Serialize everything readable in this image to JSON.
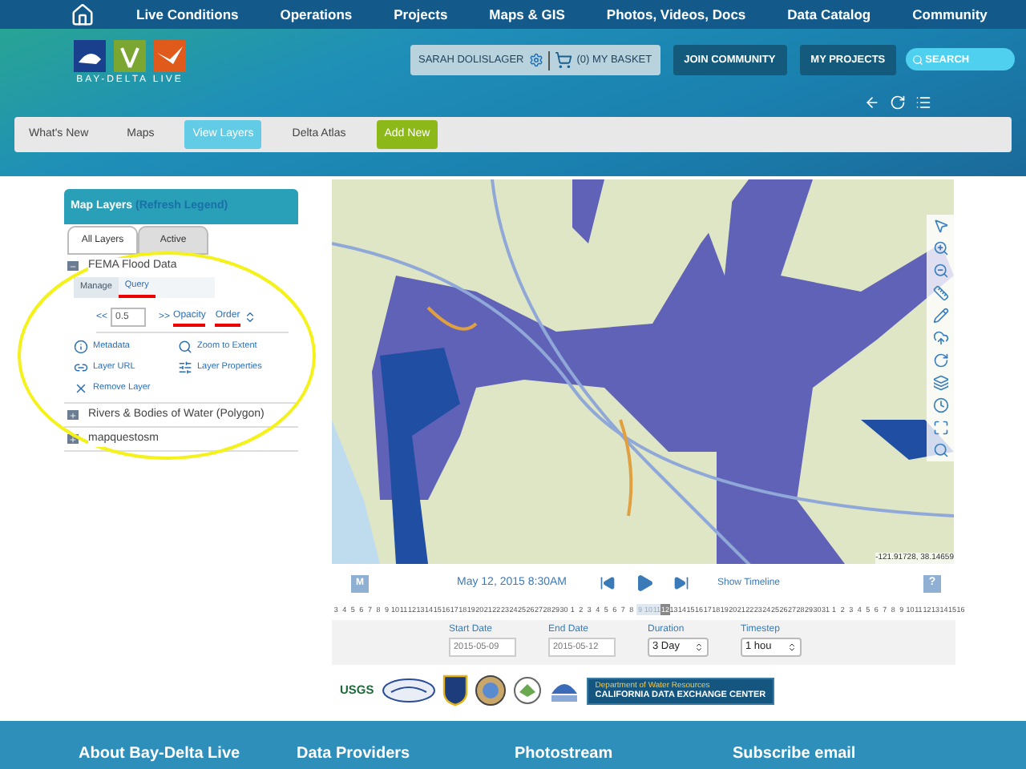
{
  "top_nav": {
    "items": [
      "Live Conditions",
      "Operations",
      "Projects",
      "Maps & GIS",
      "Photos, Videos, Docs",
      "Data Catalog",
      "Community"
    ]
  },
  "logo": {
    "text": "BAY-DELTA LIVE"
  },
  "user_bar": {
    "user": "SARAH DOLISLAGER",
    "basket": "(0) MY BASKET"
  },
  "header_buttons": [
    "JOIN COMMUNITY",
    "MY PROJECTS"
  ],
  "search": {
    "placeholder": "SEARCH"
  },
  "sub_nav": [
    {
      "label": "What's New",
      "kind": "plain",
      "selected": false
    },
    {
      "label": "Maps",
      "kind": "plain",
      "selected": false
    },
    {
      "label": "View Layers",
      "kind": "plain",
      "selected": true
    },
    {
      "label": "Delta Atlas",
      "kind": "plain",
      "selected": false
    },
    {
      "label": "Add New",
      "kind": "action",
      "selected": false
    }
  ],
  "layers_panel": {
    "title": "Map Layers",
    "refresh": "(Refresh Legend)",
    "tabs": [
      {
        "label": "All Layers",
        "selected": true
      },
      {
        "label": "Active",
        "selected": false
      }
    ],
    "layers": [
      {
        "name": "FEMA Flood Data",
        "expanded": true
      },
      {
        "name": "Rivers & Bodies of Water (Polygon)",
        "expanded": false
      },
      {
        "name": "mapquestosm",
        "expanded": false
      }
    ],
    "layer_tabs": [
      {
        "label": "Manage",
        "selected": true,
        "marked": false
      },
      {
        "label": "Query",
        "selected": false,
        "marked": true
      }
    ],
    "opacity": {
      "less": "<<",
      "value": "0.5",
      "more": ">>",
      "label": "Opacity",
      "marked": true
    },
    "order": {
      "label": "Order",
      "marked": true
    },
    "actions": [
      {
        "label": "Metadata",
        "kind": "metadata"
      },
      {
        "label": "Zoom to Extent",
        "kind": "zoom"
      },
      {
        "label": "Layer URL",
        "kind": "url"
      },
      {
        "label": "Layer Properties",
        "kind": "properties"
      },
      {
        "label": "Remove Layer",
        "kind": "remove"
      }
    ],
    "highlight_ellipse": true
  },
  "map": {
    "coordinates": "-121.91728, 38.14659"
  },
  "player": {
    "mode": "M",
    "datetime": "May 12, 2015 8:30AM",
    "timeline": "Show Timeline",
    "help": "?"
  },
  "days": [
    {
      "day": "3",
      "selected": false,
      "current": false
    },
    {
      "day": "4",
      "selected": false,
      "current": false
    },
    {
      "day": "5",
      "selected": false,
      "current": false
    },
    {
      "day": "6",
      "selected": false,
      "current": false
    },
    {
      "day": "7",
      "selected": false,
      "current": false
    },
    {
      "day": "8",
      "selected": false,
      "current": false
    },
    {
      "day": "9",
      "selected": false,
      "current": false
    },
    {
      "day": "10",
      "selected": false,
      "current": false
    },
    {
      "day": "11",
      "selected": false,
      "current": false
    },
    {
      "day": "12",
      "selected": false,
      "current": false
    },
    {
      "day": "13",
      "selected": false,
      "current": false
    },
    {
      "day": "14",
      "selected": false,
      "current": false
    },
    {
      "day": "15",
      "selected": false,
      "current": false
    },
    {
      "day": "16",
      "selected": false,
      "current": false
    },
    {
      "day": "17",
      "selected": false,
      "current": false
    },
    {
      "day": "18",
      "selected": false,
      "current": false
    },
    {
      "day": "19",
      "selected": false,
      "current": false
    },
    {
      "day": "20",
      "selected": false,
      "current": false
    },
    {
      "day": "21",
      "selected": false,
      "current": false
    },
    {
      "day": "22",
      "selected": false,
      "current": false
    },
    {
      "day": "23",
      "selected": false,
      "current": false
    },
    {
      "day": "24",
      "selected": false,
      "current": false
    },
    {
      "day": "25",
      "selected": false,
      "current": false
    },
    {
      "day": "26",
      "selected": false,
      "current": false
    },
    {
      "day": "27",
      "selected": false,
      "current": false
    },
    {
      "day": "28",
      "selected": false,
      "current": false
    },
    {
      "day": "29",
      "selected": false,
      "current": false
    },
    {
      "day": "30",
      "selected": false,
      "current": false
    },
    {
      "day": "1",
      "selected": false,
      "current": false
    },
    {
      "day": "2",
      "selected": false,
      "current": false
    },
    {
      "day": "3",
      "selected": false,
      "current": false
    },
    {
      "day": "4",
      "selected": false,
      "current": false
    },
    {
      "day": "5",
      "selected": false,
      "current": false
    },
    {
      "day": "6",
      "selected": false,
      "current": false
    },
    {
      "day": "7",
      "selected": false,
      "current": false
    },
    {
      "day": "8",
      "selected": false,
      "current": false
    },
    {
      "day": "9",
      "selected": true,
      "current": false
    },
    {
      "day": "10",
      "selected": true,
      "current": false
    },
    {
      "day": "11",
      "selected": true,
      "current": false
    },
    {
      "day": "12",
      "selected": true,
      "current": true
    },
    {
      "day": "13",
      "selected": false,
      "current": false
    },
    {
      "day": "14",
      "selected": false,
      "current": false
    },
    {
      "day": "15",
      "selected": false,
      "current": false
    },
    {
      "day": "16",
      "selected": false,
      "current": false
    },
    {
      "day": "17",
      "selected": false,
      "current": false
    },
    {
      "day": "18",
      "selected": false,
      "current": false
    },
    {
      "day": "19",
      "selected": false,
      "current": false
    },
    {
      "day": "20",
      "selected": false,
      "current": false
    },
    {
      "day": "21",
      "selected": false,
      "current": false
    },
    {
      "day": "22",
      "selected": false,
      "current": false
    },
    {
      "day": "23",
      "selected": false,
      "current": false
    },
    {
      "day": "24",
      "selected": false,
      "current": false
    },
    {
      "day": "25",
      "selected": false,
      "current": false
    },
    {
      "day": "26",
      "selected": false,
      "current": false
    },
    {
      "day": "27",
      "selected": false,
      "current": false
    },
    {
      "day": "28",
      "selected": false,
      "current": false
    },
    {
      "day": "29",
      "selected": false,
      "current": false
    },
    {
      "day": "30",
      "selected": false,
      "current": false
    },
    {
      "day": "31",
      "selected": false,
      "current": false
    },
    {
      "day": "1",
      "selected": false,
      "current": false
    },
    {
      "day": "2",
      "selected": false,
      "current": false
    },
    {
      "day": "3",
      "selected": false,
      "current": false
    },
    {
      "day": "4",
      "selected": false,
      "current": false
    },
    {
      "day": "5",
      "selected": false,
      "current": false
    },
    {
      "day": "6",
      "selected": false,
      "current": false
    },
    {
      "day": "7",
      "selected": false,
      "current": false
    },
    {
      "day": "8",
      "selected": false,
      "current": false
    },
    {
      "day": "9",
      "selected": false,
      "current": false
    },
    {
      "day": "10",
      "selected": false,
      "current": false
    },
    {
      "day": "11",
      "selected": false,
      "current": false
    },
    {
      "day": "12",
      "selected": false,
      "current": false
    },
    {
      "day": "13",
      "selected": false,
      "current": false
    },
    {
      "day": "14",
      "selected": false,
      "current": false
    },
    {
      "day": "15",
      "selected": false,
      "current": false
    },
    {
      "day": "16",
      "selected": false,
      "current": false
    }
  ],
  "range": {
    "start_label": "Start Date",
    "start": "2015-05-09",
    "end_label": "End Date",
    "end": "2015-05-12",
    "duration_label": "Duration",
    "duration": "3 Day",
    "timestep_label": "Timestep",
    "timestep": "1 hou"
  },
  "partners": {
    "usgs": "USGS",
    "dwr_line1": "Department of Water Resources",
    "dwr_line2": "CALIFORNIA DATA EXCHANGE CENTER"
  },
  "footer": [
    "About Bay-Delta Live",
    "Data Providers",
    "Photostream",
    "Subscribe email"
  ]
}
